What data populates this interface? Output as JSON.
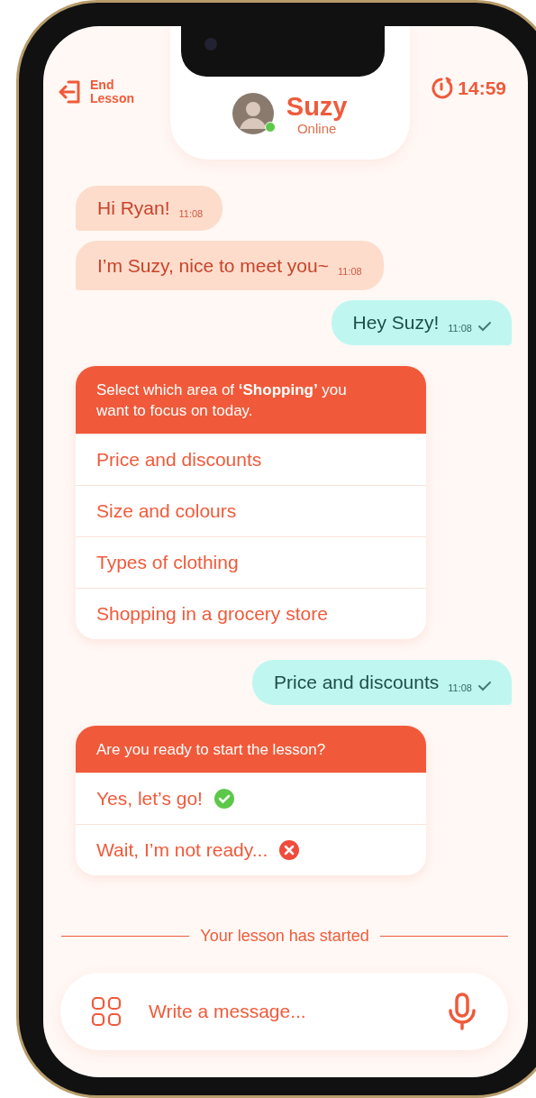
{
  "header": {
    "end_lesson": "End Lesson",
    "contact": {
      "name": "Suzy",
      "status": "Online",
      "online": true
    },
    "timer": "14:59"
  },
  "messages": [
    {
      "kind": "incoming",
      "text": "Hi Ryan!",
      "time": "11:08"
    },
    {
      "kind": "incoming",
      "text": "I’m Suzy, nice to meet you~",
      "time": "11:08"
    },
    {
      "kind": "outgoing",
      "text": "Hey Suzy!",
      "time": "11:08",
      "read": true
    },
    {
      "kind": "options",
      "prompt": "Select which area of **‘Shopping’** you want to focus on today.",
      "options": [
        {
          "label": "Price and discounts",
          "kind": "plain"
        },
        {
          "label": "Size and colours",
          "kind": "plain"
        },
        {
          "label": "Types of clothing",
          "kind": "plain"
        },
        {
          "label": "Shopping in a grocery store",
          "kind": "plain"
        }
      ]
    },
    {
      "kind": "outgoing",
      "text": "Price and discounts",
      "time": "11:08",
      "read": true
    },
    {
      "kind": "options",
      "prompt": "Are you ready to start the lesson?",
      "options": [
        {
          "label": "Yes, let’s go!",
          "kind": "confirm"
        },
        {
          "label": "Wait, I’m not ready...",
          "kind": "cancel"
        }
      ]
    }
  ],
  "divider": "Your lesson has started",
  "composer": {
    "placeholder": "Write a message..."
  }
}
